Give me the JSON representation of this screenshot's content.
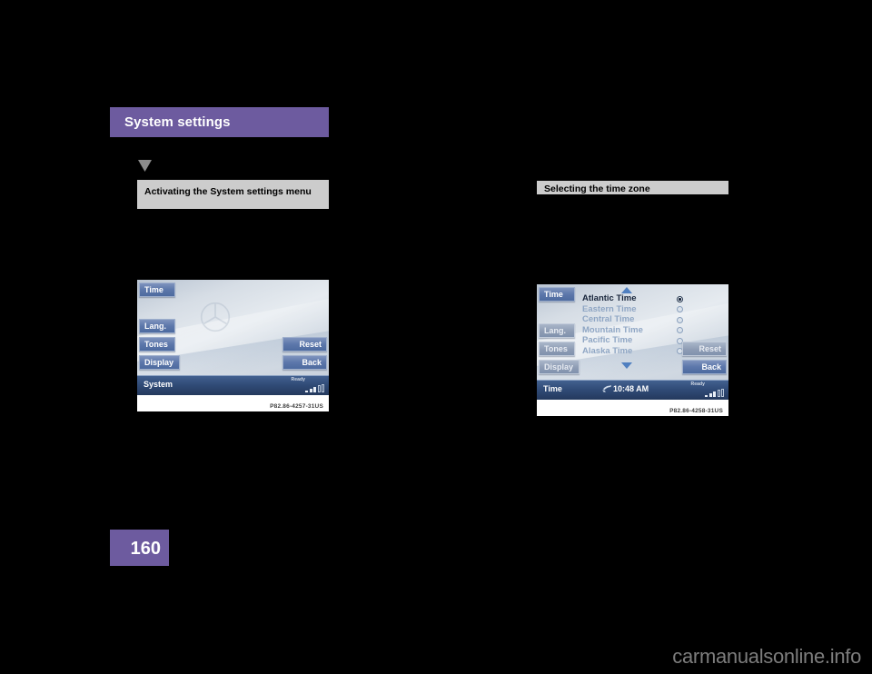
{
  "document": {
    "chapter_title": "System settings",
    "page_number": "160",
    "watermark": "carmanualsonline.info"
  },
  "left_column": {
    "section_heading": "Activating the System settings menu",
    "marker_icon": "funnel-wedge-icon",
    "figure": {
      "caption": "P82.86-4257-31US",
      "soft_keys": {
        "time": "Time",
        "lang": "Lang.",
        "tones": "Tones",
        "display": "Display",
        "reset": "Reset",
        "back": "Back"
      },
      "status_bar": {
        "label": "System",
        "ready": "Ready"
      },
      "watermark_icon": "mercedes-star-icon"
    }
  },
  "right_column": {
    "section_heading": "Selecting the time zone",
    "figure": {
      "caption": "P82.86-4258-31US",
      "soft_keys": {
        "time": "Time",
        "lang": "Lang.",
        "tones": "Tones",
        "display": "Display",
        "reset": "Reset",
        "back": "Back"
      },
      "time_zones": [
        {
          "label": "Atlantic Time",
          "selected": true
        },
        {
          "label": "Eastern Time",
          "selected": false
        },
        {
          "label": "Central Time",
          "selected": false
        },
        {
          "label": "Mountain Time",
          "selected": false
        },
        {
          "label": "Pacific Time",
          "selected": false
        },
        {
          "label": "Alaska Time",
          "selected": false
        }
      ],
      "scroll_up_icon": "triangle-up-icon",
      "scroll_down_icon": "triangle-down-icon",
      "status_bar": {
        "label": "Time",
        "clock": "10:48 AM",
        "clock_icon": "phone-handset-icon",
        "ready": "Ready"
      }
    }
  },
  "colors": {
    "accent_purple": "#6d5b9f",
    "section_heading_bg": "#cccccc",
    "screen_key_blue": "#5d78ab",
    "status_bar_blue": "#2f4a75",
    "page_background": "#000000"
  }
}
